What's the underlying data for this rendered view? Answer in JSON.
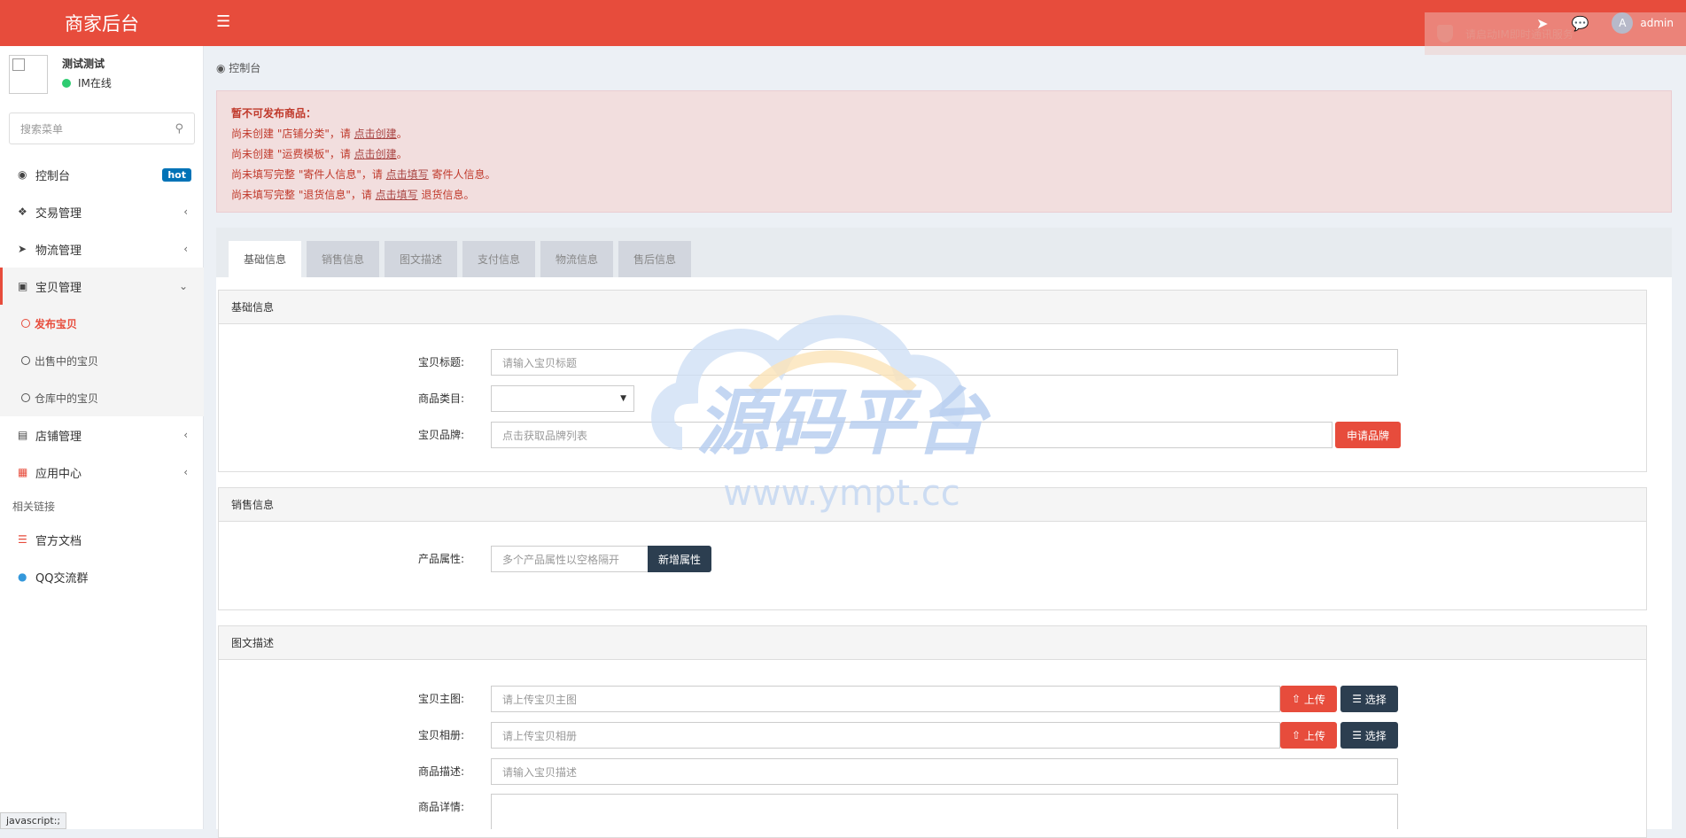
{
  "app": {
    "title": "商家后台"
  },
  "topbar": {
    "im_tip": "请启动IM即时通讯服务",
    "user": "admin",
    "avatar_letter": "A"
  },
  "user": {
    "name": "测试测试",
    "status": "IM在线"
  },
  "search": {
    "placeholder": "搜索菜单"
  },
  "menu": {
    "dashboard": "控制台",
    "hot": "hot",
    "trade": "交易管理",
    "logistics": "物流管理",
    "goods": "宝贝管理",
    "goods_sub": [
      "发布宝贝",
      "出售中的宝贝",
      "仓库中的宝贝"
    ],
    "shop": "店铺管理",
    "apps": "应用中心",
    "links_header": "相关链接",
    "docs": "官方文档",
    "qq": "QQ交流群"
  },
  "breadcrumb": "控制台",
  "alert": {
    "title": "暂不可发布商品：",
    "lines": [
      {
        "pre": "尚未创建 \"店铺分类\"，请 ",
        "link": "点击创建",
        "post": "。"
      },
      {
        "pre": "尚未创建 \"运费模板\"，请 ",
        "link": "点击创建",
        "post": "。"
      },
      {
        "pre": "尚未填写完整 \"寄件人信息\"，请 ",
        "link": "点击填写",
        "post": " 寄件人信息。"
      },
      {
        "pre": "尚未填写完整 \"退货信息\"，请 ",
        "link": "点击填写",
        "post": " 退货信息。"
      }
    ]
  },
  "tabs": [
    "基础信息",
    "销售信息",
    "图文描述",
    "支付信息",
    "物流信息",
    "售后信息"
  ],
  "basic": {
    "header": "基础信息",
    "title_label": "宝贝标题:",
    "title_placeholder": "请输入宝贝标题",
    "category_label": "商品类目:",
    "brand_label": "宝贝品牌:",
    "brand_placeholder": "点击获取品牌列表",
    "brand_button": "申请品牌"
  },
  "sales": {
    "header": "销售信息",
    "attr_label": "产品属性:",
    "attr_placeholder": "多个产品属性以空格隔开",
    "attr_button": "新增属性"
  },
  "desc": {
    "header": "图文描述",
    "main_label": "宝贝主图:",
    "main_placeholder": "请上传宝贝主图",
    "album_label": "宝贝相册:",
    "album_placeholder": "请上传宝贝相册",
    "desc_label": "商品描述:",
    "desc_placeholder": "请输入宝贝描述",
    "detail_label": "商品详情:",
    "upload": "上传",
    "choose": "选择"
  },
  "watermark": {
    "brand": "源码平台",
    "url": "www.ympt.cc"
  },
  "statusbar": "javascript:;",
  "colors": {
    "accent": "#e74c3c",
    "dark_button": "#2c3e50",
    "hot_badge": "#0073b7",
    "online": "#2ecc71"
  }
}
